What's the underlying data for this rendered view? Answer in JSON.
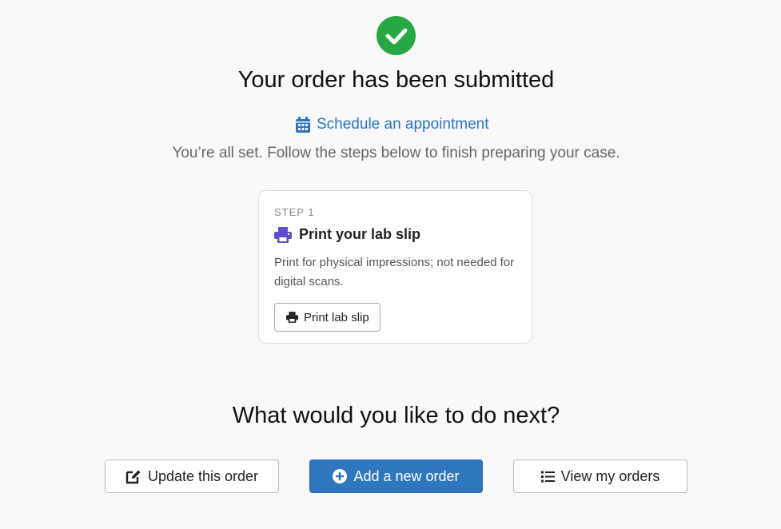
{
  "header": {
    "status_icon": "check-circle-icon",
    "title": "Your order has been submitted",
    "schedule_link": "Schedule an appointment",
    "subtitle": "You’re all set. Follow the steps below to finish preparing your case."
  },
  "step_card": {
    "step_label": "STEP 1",
    "title": "Print your lab slip",
    "description": "Print for physical impressions; not needed for digital scans.",
    "button_label": "Print lab slip",
    "icon": "printer-icon"
  },
  "next": {
    "heading": "What would you like to do next?",
    "actions": [
      {
        "label": "Update this order",
        "icon": "edit-icon"
      },
      {
        "label": "Add a new order",
        "icon": "plus-circle-icon"
      },
      {
        "label": "View my orders",
        "icon": "list-icon"
      }
    ]
  },
  "colors": {
    "success": "#28a745",
    "link": "#2b74c4",
    "primary": "#2e76bd",
    "step_icon": "#5b4fd0"
  }
}
